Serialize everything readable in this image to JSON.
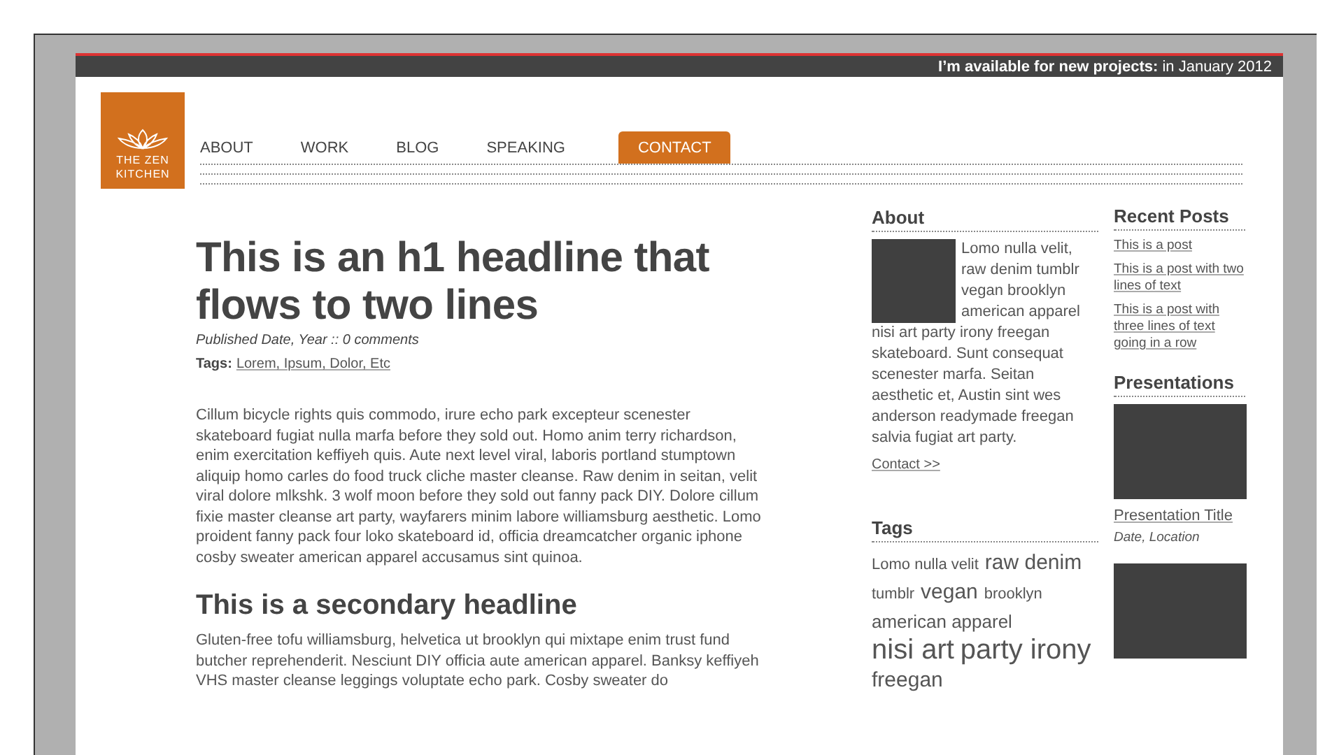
{
  "top_bar": {
    "label": "I’m available for new projects:",
    "value": "in January 2012"
  },
  "logo": {
    "line1": "THE ZEN",
    "line2": "KITCHEN"
  },
  "nav": [
    {
      "label": "ABOUT",
      "selected": false
    },
    {
      "label": "WORK",
      "selected": false
    },
    {
      "label": "BLOG",
      "selected": false
    },
    {
      "label": "SPEAKING",
      "selected": false
    },
    {
      "label": "CONTACT",
      "selected": true
    }
  ],
  "article": {
    "title": "This is an h1 headline that flows to two lines",
    "meta": "Published Date, Year :: 0 comments",
    "tags_label": "Tags:",
    "tags": "Lorem, Ipsum, Dolor, Etc",
    "body": "Cillum bicycle rights quis commodo, irure echo park excepteur scenester skateboard fugiat nulla marfa before they sold out. Homo anim terry richardson, enim exercitation keffiyeh quis. Aute next level viral, laboris portland stumptown aliquip homo carles do food truck cliche master cleanse. Raw denim in seitan, velit viral dolore mlkshk. 3 wolf moon before they sold out fanny pack DIY. Dolore cillum fixie master cleanse art party, wayfarers minim labore williamsburg aesthetic. Lomo proident fanny pack four loko skateboard id, officia dreamcatcher organic iphone cosby sweater american apparel accusamus sint quinoa.",
    "subtitle": "This is a secondary headline",
    "body2": "Gluten-free tofu williamsburg, helvetica ut brooklyn qui mixtape enim trust fund butcher reprehenderit. Nesciunt DIY officia aute american apparel. Banksy keffiyeh VHS master cleanse leggings voluptate echo park. Cosby sweater do"
  },
  "about": {
    "title": "About",
    "text_beside": "Lomo nulla velit, raw denim tumblr vegan brooklyn american apparel",
    "text": "nisi art party irony freegan skateboard. Sunt consequat scenester marfa. Seitan aesthetic et, Austin sint wes anderson readymade freegan salvia fugiat art party.",
    "link": "Contact >>"
  },
  "tags": {
    "title": "Tags",
    "items": [
      {
        "label": "Lomo nulla velit",
        "kind": "small"
      },
      {
        "label": "raw denim",
        "kind": "large"
      },
      {
        "label": "tumblr",
        "kind": "small"
      },
      {
        "label": "vegan",
        "kind": "large"
      },
      {
        "label": "brooklyn",
        "kind": "small"
      },
      {
        "label": "american apparel",
        "kind": "medium"
      },
      {
        "label": "nisi art",
        "kind": "huge"
      },
      {
        "label": "party irony",
        "kind": "huge"
      },
      {
        "label": "freegan",
        "kind": "large"
      }
    ]
  },
  "recent_posts": {
    "title": "Recent Posts",
    "items": [
      "This is a post",
      "This is a post with two lines of text",
      "This is a post with three lines of text going in a row"
    ]
  },
  "presentations": {
    "title": "Presentations",
    "items": [
      {
        "kind": "titled",
        "title": "Presentation Title",
        "meta": "Date, Location"
      },
      {
        "kind": "image_only"
      }
    ]
  }
}
